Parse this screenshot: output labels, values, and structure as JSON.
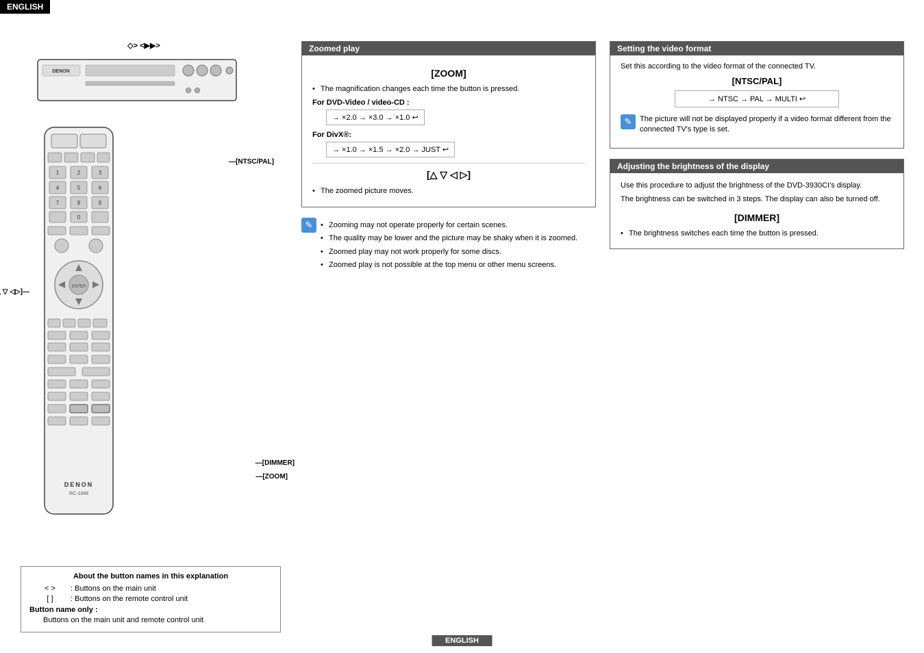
{
  "header": {
    "language": "ENGLISH"
  },
  "footer": {
    "language": "ENGLISH"
  },
  "left": {
    "zoom_arrows_label": "◇> <▶▶>",
    "ntsc_pal_label": "[NTSC/PAL]",
    "nav_label": "[△ ▽ ◁▷]",
    "dimmer_label": "[DIMMER]",
    "zoom_label": "[ZOOM]"
  },
  "legend": {
    "title": "About the button names in this explanation",
    "row1_symbol": "< >",
    "row1_desc": ": Buttons on the main unit",
    "row2_symbol": "[ ]",
    "row2_desc": ": Buttons on the remote control unit",
    "row3_label": "Button name only :",
    "row3_desc": "Buttons on the main unit and remote control unit"
  },
  "zoomed_play": {
    "section_title": "Zoomed play",
    "zoom_button": "[ZOOM]",
    "zoom_desc": "The magnification changes each time the button is pressed.",
    "dvd_label": "For DVD-Video / video-CD :",
    "dvd_flow": [
      "× 2.0",
      "→",
      "× 3.0",
      "→",
      "× 1.0",
      "↩"
    ],
    "divx_label": "For DivX®:",
    "divx_flow": [
      "× 1.0",
      "→",
      "× 1.5",
      "→",
      "× 2.0",
      "→",
      "JUST",
      "↩"
    ],
    "nav_button": "[△ ▽ ◁ ▷]",
    "nav_desc": "The zoomed picture moves.",
    "notes": [
      "Zooming may not operate properly for certain scenes.",
      "The quality may be lower and the picture may be shaky when it is zoomed.",
      "Zoomed play may not work properly for some discs.",
      "Zoomed play is not possible at the top menu or other menu screens."
    ]
  },
  "video_format": {
    "section_title": "Setting the video format",
    "intro": "Set this according to the video format of the connected TV.",
    "button": "[NTSC/PAL]",
    "flow": [
      "NTSC",
      "→",
      "PAL",
      "→",
      "MULTI",
      "↩"
    ],
    "note": "The picture will not be displayed properly if a video format different from the connected TV's type is set."
  },
  "brightness": {
    "section_title": "Adjusting the brightness of the display",
    "intro1": "Use this procedure to adjust the brightness of the DVD-3930CI's display.",
    "intro2": "The brightness can be switched in 3 steps. The display can also be turned off.",
    "button": "[DIMMER]",
    "desc": "The brightness switches each time the button is pressed."
  }
}
